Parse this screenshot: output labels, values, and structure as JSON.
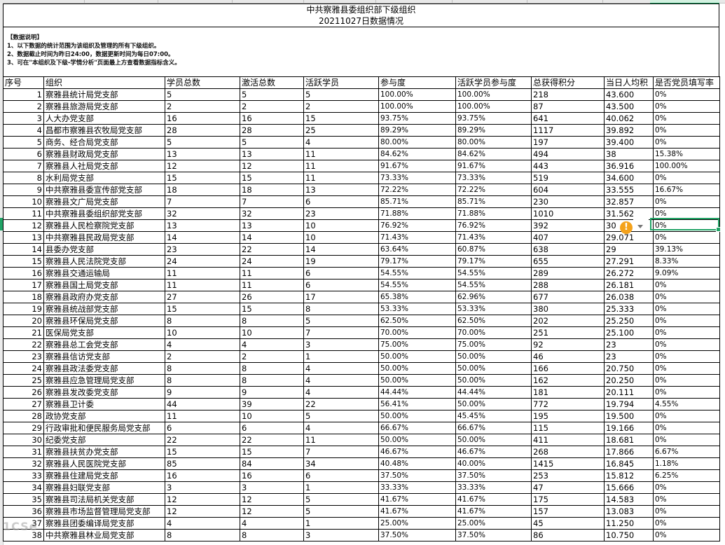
{
  "title": {
    "line1": "中共察雅县委组织部下级组织",
    "line2": "20211027日数据情况"
  },
  "notes": {
    "heading": "【数据说明】",
    "items": [
      "1、以下数据的统计范围为该组织及管理的所有下级组织。",
      "2、数据截止时间为昨日24:00，数据更新时间为每日07:00。",
      "3、可在\"本组织及下级-学情分析\"页面最上方查看数据指标含义。"
    ]
  },
  "headers": [
    "序号",
    "组织",
    "学员总数",
    "激活总数",
    "活跃学员",
    "参与度",
    "活跃学员参与度",
    "总获得积分",
    "当日人均积",
    "是否党员填写率"
  ],
  "rows": [
    [
      "1",
      "察雅县统计局党支部",
      "5",
      "5",
      "5",
      "100.00%",
      "100.00%",
      "218",
      "43.600",
      "0%"
    ],
    [
      "2",
      "察雅县旅游局党支部",
      "2",
      "2",
      "2",
      "100.00%",
      "100.00%",
      "87",
      "43.500",
      "0%"
    ],
    [
      "3",
      "人大办党支部",
      "16",
      "16",
      "15",
      "93.75%",
      "93.75%",
      "641",
      "40.062",
      "0%"
    ],
    [
      "4",
      "昌都市察雅县农牧局党支部",
      "28",
      "28",
      "25",
      "89.29%",
      "89.29%",
      "1117",
      "39.892",
      "0%"
    ],
    [
      "5",
      "商务、经合局党支部",
      "5",
      "5",
      "4",
      "80.00%",
      "80.00%",
      "197",
      "39.400",
      "0%"
    ],
    [
      "6",
      "察雅县财政局党支部",
      "13",
      "13",
      "11",
      "84.62%",
      "84.62%",
      "494",
      "38",
      "15.38%"
    ],
    [
      "7",
      "察雅县人社局党支部",
      "12",
      "12",
      "11",
      "91.67%",
      "91.67%",
      "443",
      "36.916",
      "100.00%"
    ],
    [
      "8",
      "水利局党支部",
      "15",
      "15",
      "11",
      "73.33%",
      "73.33%",
      "519",
      "34.600",
      "0%"
    ],
    [
      "9",
      "中共察雅县委宣传部党支部",
      "18",
      "18",
      "13",
      "72.22%",
      "72.22%",
      "604",
      "33.555",
      "16.67%"
    ],
    [
      "10",
      "察雅县文广局党支部",
      "7",
      "7",
      "6",
      "85.71%",
      "85.71%",
      "230",
      "32.857",
      "0%"
    ],
    [
      "11",
      "中共察雅县委组织部党支部",
      "32",
      "32",
      "23",
      "71.88%",
      "71.88%",
      "1010",
      "31.562",
      "0%"
    ],
    [
      "12",
      "察雅县人民检察院党支部",
      "13",
      "13",
      "10",
      "76.92%",
      "76.92%",
      "392",
      "30",
      "0%"
    ],
    [
      "13",
      "中共察雅县民政局党支部",
      "14",
      "14",
      "10",
      "71.43%",
      "71.43%",
      "407",
      "29.071",
      "0%"
    ],
    [
      "14",
      "县委办党支部",
      "23",
      "22",
      "14",
      "63.64%",
      "60.87%",
      "638",
      "29",
      "39.13%"
    ],
    [
      "15",
      "察雅县人民法院党支部",
      "24",
      "24",
      "19",
      "79.17%",
      "79.17%",
      "655",
      "27.291",
      "8.33%"
    ],
    [
      "16",
      "察雅县交通运输局",
      "11",
      "11",
      "6",
      "54.55%",
      "54.55%",
      "289",
      "26.272",
      "9.09%"
    ],
    [
      "17",
      "察雅县国土局党支部",
      "11",
      "11",
      "6",
      "54.55%",
      "54.55%",
      "288",
      "26.181",
      "0%"
    ],
    [
      "18",
      "察雅县政府办党支部",
      "27",
      "26",
      "17",
      "65.38%",
      "62.96%",
      "677",
      "26.038",
      "0%"
    ],
    [
      "19",
      "察雅县统战部党支部",
      "15",
      "15",
      "8",
      "53.33%",
      "53.33%",
      "380",
      "25.333",
      "0%"
    ],
    [
      "20",
      "察雅县环保局党支部",
      "8",
      "8",
      "5",
      "62.50%",
      "62.50%",
      "202",
      "25.250",
      "0%"
    ],
    [
      "21",
      "医保局党支部",
      "10",
      "10",
      "7",
      "70.00%",
      "70.00%",
      "251",
      "25.100",
      "0%"
    ],
    [
      "22",
      "察雅县总工会党支部",
      "4",
      "4",
      "3",
      "75.00%",
      "75.00%",
      "92",
      "23",
      "0%"
    ],
    [
      "23",
      "察雅县信访党支部",
      "2",
      "2",
      "1",
      "50.00%",
      "50.00%",
      "46",
      "23",
      "0%"
    ],
    [
      "24",
      "察雅县政法委党支部",
      "8",
      "8",
      "4",
      "50.00%",
      "50.00%",
      "166",
      "20.750",
      "0%"
    ],
    [
      "25",
      "察雅县应急管理局党支部",
      "8",
      "8",
      "4",
      "50.00%",
      "50.00%",
      "162",
      "20.250",
      "0%"
    ],
    [
      "26",
      "察雅县发改委党支部",
      "9",
      "9",
      "4",
      "44.44%",
      "44.44%",
      "181",
      "20.111",
      "0%"
    ],
    [
      "27",
      "察雅县卫计委",
      "44",
      "39",
      "22",
      "56.41%",
      "50.00%",
      "772",
      "19.794",
      "4.55%"
    ],
    [
      "28",
      "政协党支部",
      "11",
      "10",
      "5",
      "50.00%",
      "45.45%",
      "195",
      "19.500",
      "0%"
    ],
    [
      "29",
      "行政审批和便民服务局党支部",
      "6",
      "6",
      "4",
      "66.67%",
      "66.67%",
      "115",
      "19.166",
      "0%"
    ],
    [
      "30",
      "纪委党支部",
      "22",
      "22",
      "11",
      "50.00%",
      "50.00%",
      "411",
      "18.681",
      "0%"
    ],
    [
      "31",
      "察雅县扶贫办党支部",
      "15",
      "15",
      "7",
      "46.67%",
      "46.67%",
      "268",
      "17.866",
      "6.67%"
    ],
    [
      "32",
      "察雅县人民医院党支部",
      "85",
      "84",
      "34",
      "40.48%",
      "40.00%",
      "1415",
      "16.845",
      "1.18%"
    ],
    [
      "33",
      "察雅县住建局党支部",
      "16",
      "16",
      "6",
      "37.50%",
      "37.50%",
      "253",
      "15.812",
      "6.25%"
    ],
    [
      "34",
      "察雅县妇联党支部",
      "3",
      "3",
      "1",
      "33.33%",
      "33.33%",
      "47",
      "15.666",
      "0%"
    ],
    [
      "35",
      "察雅县司法局机关党支部",
      "12",
      "12",
      "5",
      "41.67%",
      "41.67%",
      "175",
      "14.583",
      "0%"
    ],
    [
      "36",
      "察雅县市场监督管理局党支部",
      "12",
      "12",
      "5",
      "41.67%",
      "41.67%",
      "157",
      "13.083",
      "0%"
    ],
    [
      "37",
      "察雅县团委编译局党支部",
      "4",
      "4",
      "1",
      "25.00%",
      "25.00%",
      "45",
      "11.250",
      "0%"
    ],
    [
      "38",
      "中共察雅县林业局党支部",
      "8",
      "8",
      "3",
      "37.50%",
      "37.50%",
      "86",
      "10.750",
      "0%"
    ]
  ],
  "status": {
    "warning_icon": "warning-icon",
    "warning_glyph": "!",
    "watermark": "1CSe"
  },
  "colors": {
    "selection": "#21a366",
    "warning": "#f4a21b"
  }
}
